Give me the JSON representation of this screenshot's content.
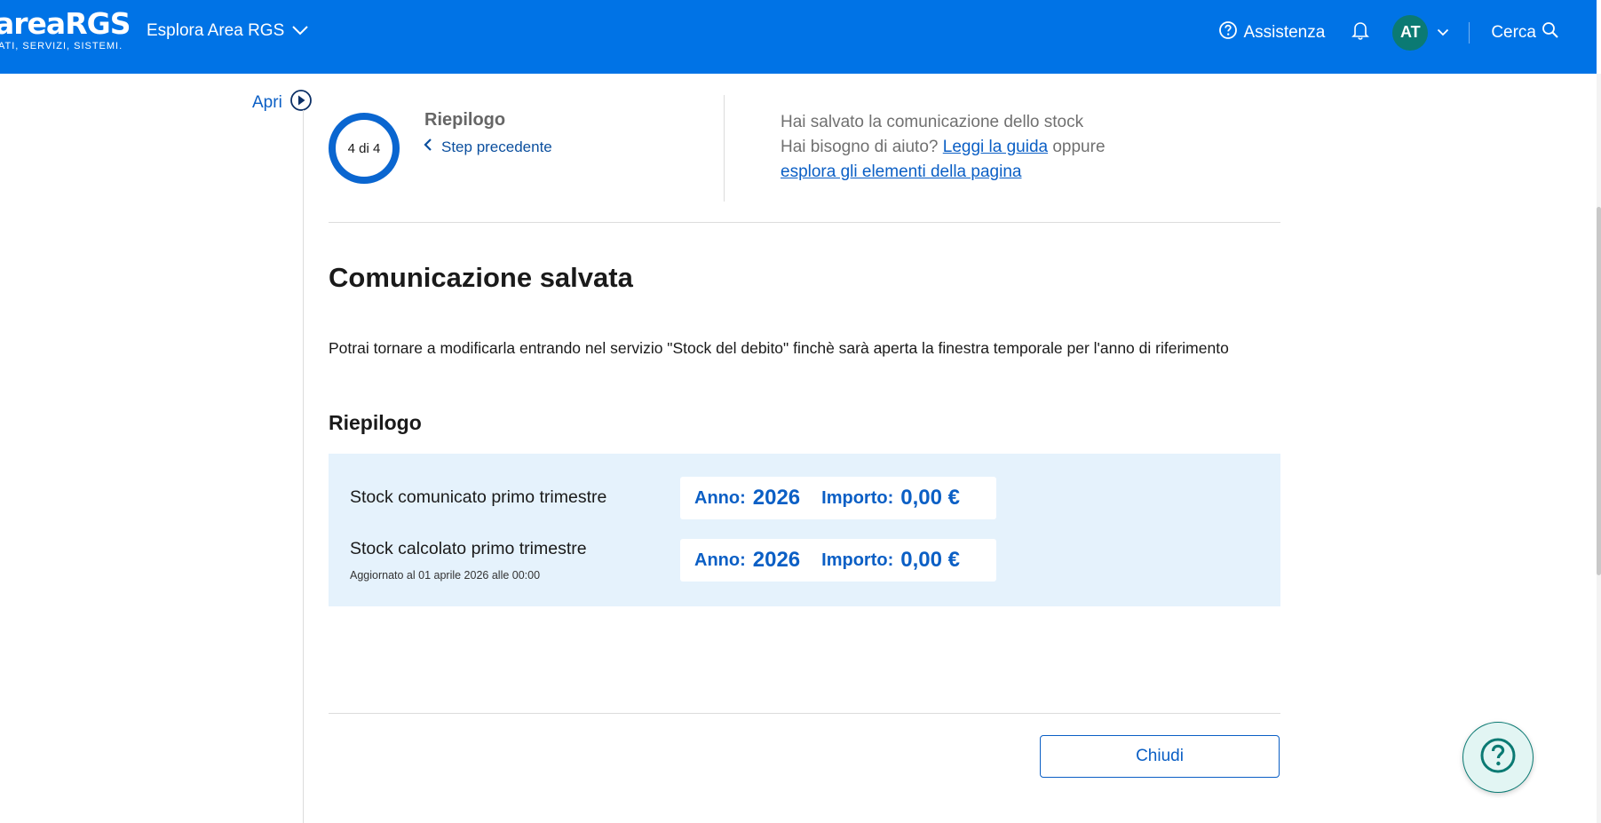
{
  "header": {
    "logo_word": "areaRGS",
    "logo_tagline": "ATI, SERVIZI, SISTEMI.",
    "explore_label": "Esplora Area RGS",
    "assist_label": "Assistenza",
    "avatar_initials": "AT",
    "search_label": "Cerca"
  },
  "sidebar": {
    "open_label": "Apri"
  },
  "step": {
    "progress": "4 di 4",
    "title": "Riepilogo",
    "previous_label": "Step precedente"
  },
  "help": {
    "line1": "Hai salvato la comunicazione dello stock",
    "line2_prefix": "Hai bisogno di aiuto?",
    "guide_link": "Leggi la guida",
    "line2_suffix": "oppure",
    "explore_link": "esplora gli elementi della pagina"
  },
  "main": {
    "title": "Comunicazione salvata",
    "description": "Potrai tornare a modificarla entrando nel servizio \"Stock del debito\" finchè sarà aperta la finestra temporale per l'anno di riferimento",
    "summary_title": "Riepilogo",
    "rows": [
      {
        "label": "Stock comunicato primo trimestre",
        "sub": "",
        "year_key": "Anno:",
        "year": "2026",
        "amount_key": "Importo:",
        "amount": "0,00 €"
      },
      {
        "label": "Stock calcolato primo trimestre",
        "sub": "Aggiornato al 01 aprile 2026 alle 00:00",
        "year_key": "Anno:",
        "year": "2026",
        "amount_key": "Importo:",
        "amount": "0,00 €"
      }
    ],
    "close_label": "Chiudi"
  },
  "icons": {
    "explore_chevron": "chevron-down-icon",
    "assist": "question-circle-icon",
    "bell": "bell-icon",
    "avatar_chevron": "chevron-down-icon",
    "search": "search-icon",
    "open_sidebar": "play-circle-icon",
    "prev_step": "chevron-left-icon",
    "help_fab": "question-icon"
  },
  "colors": {
    "header_bg": "#0073e6",
    "accent": "#0b5fc5",
    "avatar_bg": "#0b7a73",
    "summary_bg": "#e5f2fc",
    "fab_bg": "#e2f5f3"
  }
}
